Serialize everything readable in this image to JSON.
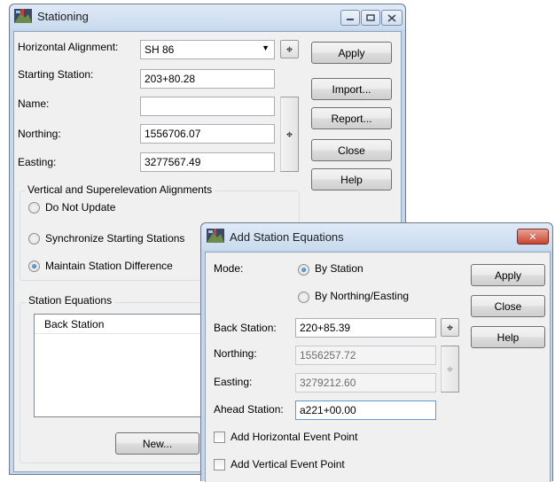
{
  "colors": {
    "title_bar": "#c9dbef",
    "client": "#f0f0f0",
    "close_red": "#c8452f"
  },
  "icons": {
    "app": "surveying-app-icon",
    "minimize": "minimize-icon",
    "maximize": "maximize-icon",
    "close": "close-icon",
    "pick": "crosshair-icon"
  },
  "stationing": {
    "title": "Stationing",
    "horizontal_alignment_label": "Horizontal Alignment:",
    "horizontal_alignment_value": "SH 86",
    "starting_station_label": "Starting Station:",
    "starting_station_value": "203+80.28",
    "name_label": "Name:",
    "name_value": "",
    "northing_label": "Northing:",
    "northing_value": "1556706.07",
    "easting_label": "Easting:",
    "easting_value": "3277567.49",
    "buttons": {
      "apply": "Apply",
      "import": "Import...",
      "report": "Report...",
      "close": "Close",
      "help": "Help"
    },
    "vertical_group_title": "Vertical and Superelevation Alignments",
    "radio_do_not_update": "Do Not Update",
    "radio_synchronize": "Synchronize Starting Stations",
    "radio_maintain": "Maintain Station Difference",
    "equations_group_title": "Station Equations",
    "equations_column": "Back Station",
    "new_button": "New..."
  },
  "add_station_equations": {
    "title": "Add Station Equations",
    "mode_label": "Mode:",
    "mode_by_station": "By Station",
    "mode_by_northing_easting": "By Northing/Easting",
    "back_station_label": "Back Station:",
    "back_station_value": "220+85.39",
    "northing_label": "Northing:",
    "northing_value": "1556257.72",
    "easting_label": "Easting:",
    "easting_value": "3279212.60",
    "ahead_station_label": "Ahead Station:",
    "ahead_station_value": "a221+00.00",
    "add_horizontal_event": "Add Horizontal Event Point",
    "add_vertical_event": "Add Vertical Event Point",
    "buttons": {
      "apply": "Apply",
      "close": "Close",
      "help": "Help"
    }
  }
}
